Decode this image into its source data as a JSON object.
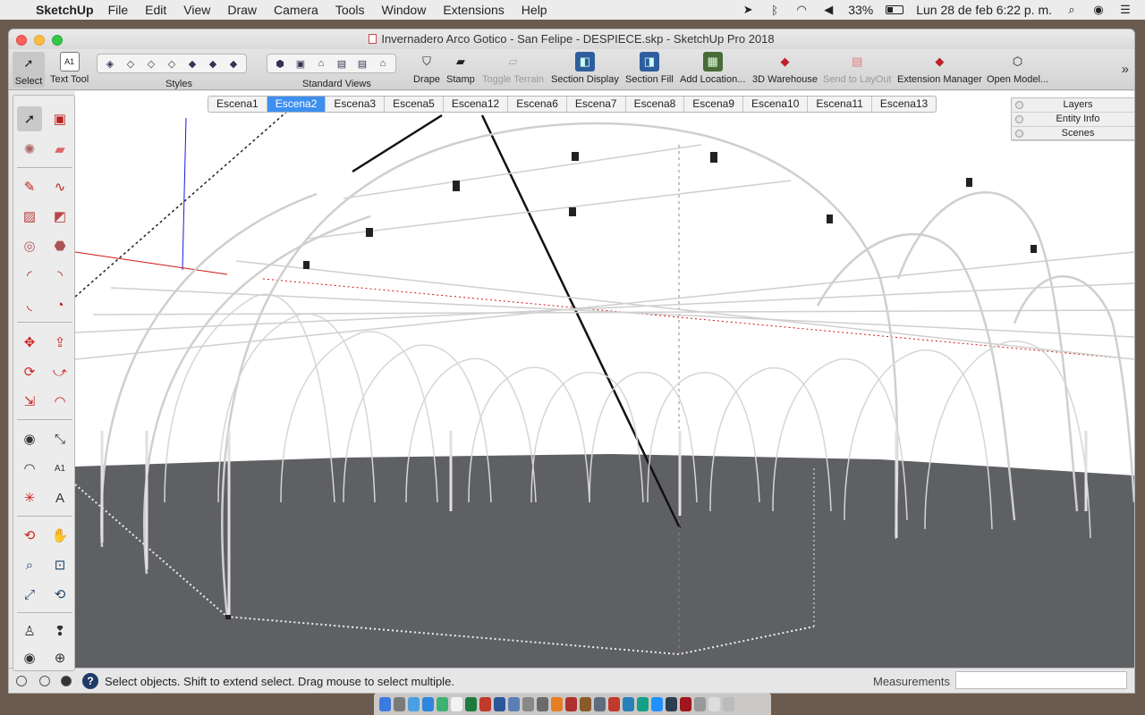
{
  "menubar": {
    "app_name": "SketchUp",
    "items": [
      "File",
      "Edit",
      "View",
      "Draw",
      "Camera",
      "Tools",
      "Window",
      "Extensions",
      "Help"
    ],
    "battery": "33%",
    "clock": "Lun 28 de feb  6:22 p. m."
  },
  "window": {
    "title": "Invernadero Arco Gotico - San Felipe - DESPIECE.skp - SketchUp Pro 2018"
  },
  "toolbar": {
    "select_label": "Select",
    "text_tool_label": "Text Tool",
    "styles_label": "Styles",
    "standard_views_label": "Standard Views",
    "drape_label": "Drape",
    "stamp_label": "Stamp",
    "toggle_terrain_label": "Toggle Terrain",
    "section_display_label": "Section Display",
    "section_fill_label": "Section Fill",
    "add_location_label": "Add Location...",
    "warehouse_label": "3D Warehouse",
    "send_layout_label": "Send to LayOut",
    "extension_manager_label": "Extension Manager",
    "open_model_label": "Open Model..."
  },
  "scenes": {
    "active": "Escena2",
    "tabs": [
      "Escena1",
      "Escena2",
      "Escena3",
      "Escena5",
      "Escena12",
      "Escena6",
      "Escena7",
      "Escena8",
      "Escena9",
      "Escena10",
      "Escena11",
      "Escena13"
    ]
  },
  "tray": {
    "panels": [
      "Layers",
      "Entity Info",
      "Scenes"
    ]
  },
  "statusbar": {
    "message": "Select objects. Shift to extend select. Drag mouse to select multiple.",
    "measurements_label": "Measurements",
    "measurements_value": ""
  },
  "colors": {
    "ground": "#5f6063",
    "active_tab": "#3d8ff0",
    "red_axis": "#d41414",
    "blue_axis": "#1a1adf"
  }
}
